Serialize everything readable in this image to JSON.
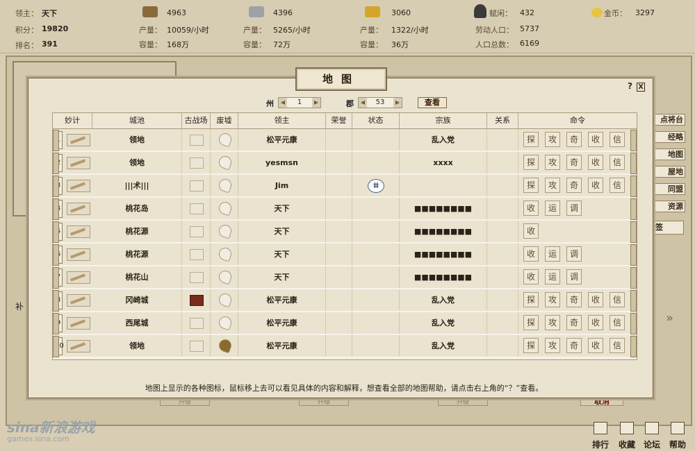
{
  "topbar": {
    "lord_label": "领主：",
    "lord_value": "天下",
    "score_label": "积分：",
    "score_value": "19820",
    "rank_label": "排名：",
    "rank_value": "391",
    "resources": [
      {
        "icon": "wood-icon",
        "color": "#8b6a3a",
        "amount": "4963",
        "prod_label": "产量：",
        "prod": "10059/小时",
        "cap_label": "容量：",
        "cap": "168万"
      },
      {
        "icon": "iron-icon",
        "color": "#9ea2a6",
        "amount": "4396",
        "prod_label": "产量：",
        "prod": "5265/小时",
        "cap_label": "容量：",
        "cap": "72万"
      },
      {
        "icon": "grain-icon",
        "color": "#d4a52a",
        "amount": "3060",
        "prod_label": "产量：",
        "prod": "1322/小时",
        "cap_label": "容量：",
        "cap": "36万"
      }
    ],
    "idle_label": "赋闲：",
    "idle_value": "432",
    "labor_label": "劳动人口：",
    "labor_value": "5737",
    "pop_label": "人口总数：",
    "pop_value": "6169",
    "gold_label": "金币：",
    "gold_value": "3297"
  },
  "side_menu": [
    "点将台",
    "经略",
    "地图",
    "屋地",
    "同盟",
    "资源"
  ],
  "side_tab": "签",
  "left_text": "补",
  "modal": {
    "title": "地图",
    "help": "?",
    "close": "X",
    "zhou_label": "州",
    "zhou_value": "1",
    "jun_label": "郡",
    "jun_value": "53",
    "view_button": "查看",
    "headers": [
      "妙计",
      "城池",
      "古战场",
      "废墟",
      "领主",
      "荣誉",
      "状态",
      "宗族",
      "关系",
      "命令"
    ],
    "rows": [
      {
        "no": "1",
        "city": "领地",
        "battle": false,
        "ruin": false,
        "lord": "松平元康",
        "status": "",
        "clan": "乱入党",
        "cmds": [
          "探",
          "攻",
          "奇",
          "收",
          "信"
        ]
      },
      {
        "no": "2",
        "city": "领地",
        "battle": false,
        "ruin": false,
        "lord": "yesmsn",
        "status": "",
        "clan": "xxxx",
        "cmds": [
          "探",
          "攻",
          "奇",
          "收",
          "信"
        ]
      },
      {
        "no": "3",
        "city": "|||术|||",
        "battle": false,
        "ruin": false,
        "lord": "Jim",
        "status": "ⵌ",
        "clan": "",
        "cmds": [
          "探",
          "攻",
          "奇",
          "收",
          "信"
        ]
      },
      {
        "no": "4",
        "city": "桃花岛",
        "battle": false,
        "ruin": false,
        "lord": "天下",
        "status": "",
        "clan": "■■■■■■■■",
        "cmds": [
          "收",
          "运",
          "调"
        ]
      },
      {
        "no": "5",
        "city": "桃花源",
        "battle": false,
        "ruin": false,
        "lord": "天下",
        "status": "",
        "clan": "■■■■■■■■",
        "cmds": [
          "收"
        ]
      },
      {
        "no": "6",
        "city": "桃花源",
        "battle": false,
        "ruin": false,
        "lord": "天下",
        "status": "",
        "clan": "■■■■■■■■",
        "cmds": [
          "收",
          "运",
          "调"
        ]
      },
      {
        "no": "7",
        "city": "桃花山",
        "battle": false,
        "ruin": false,
        "lord": "天下",
        "status": "",
        "clan": "■■■■■■■■",
        "cmds": [
          "收",
          "运",
          "调"
        ]
      },
      {
        "no": "8",
        "city": "冈崎城",
        "battle": true,
        "ruin": false,
        "lord": "松平元康",
        "status": "",
        "clan": "乱入党",
        "cmds": [
          "探",
          "攻",
          "奇",
          "收",
          "信"
        ]
      },
      {
        "no": "9",
        "city": "西尾城",
        "battle": false,
        "ruin": false,
        "lord": "松平元康",
        "status": "",
        "clan": "乱入党",
        "cmds": [
          "探",
          "攻",
          "奇",
          "收",
          "信"
        ]
      },
      {
        "no": "10",
        "city": "领地",
        "battle": false,
        "ruin": true,
        "lord": "松平元康",
        "status": "",
        "clan": "乱入党",
        "cmds": [
          "探",
          "攻",
          "奇",
          "收",
          "信"
        ]
      }
    ],
    "footnote": "地图上显示的各种图标，鼠标移上去可以看见具体的内容和解释，想查看全部的地图帮助，请点击右上角的“？”查看。"
  },
  "bottom": {
    "buttons": [
      "排行",
      "收藏",
      "论坛",
      "帮助"
    ],
    "cancel": "取消",
    "upgrade": "升级"
  },
  "watermark": {
    "logo": "sina新浪游戏",
    "url": "games.sina.com"
  }
}
